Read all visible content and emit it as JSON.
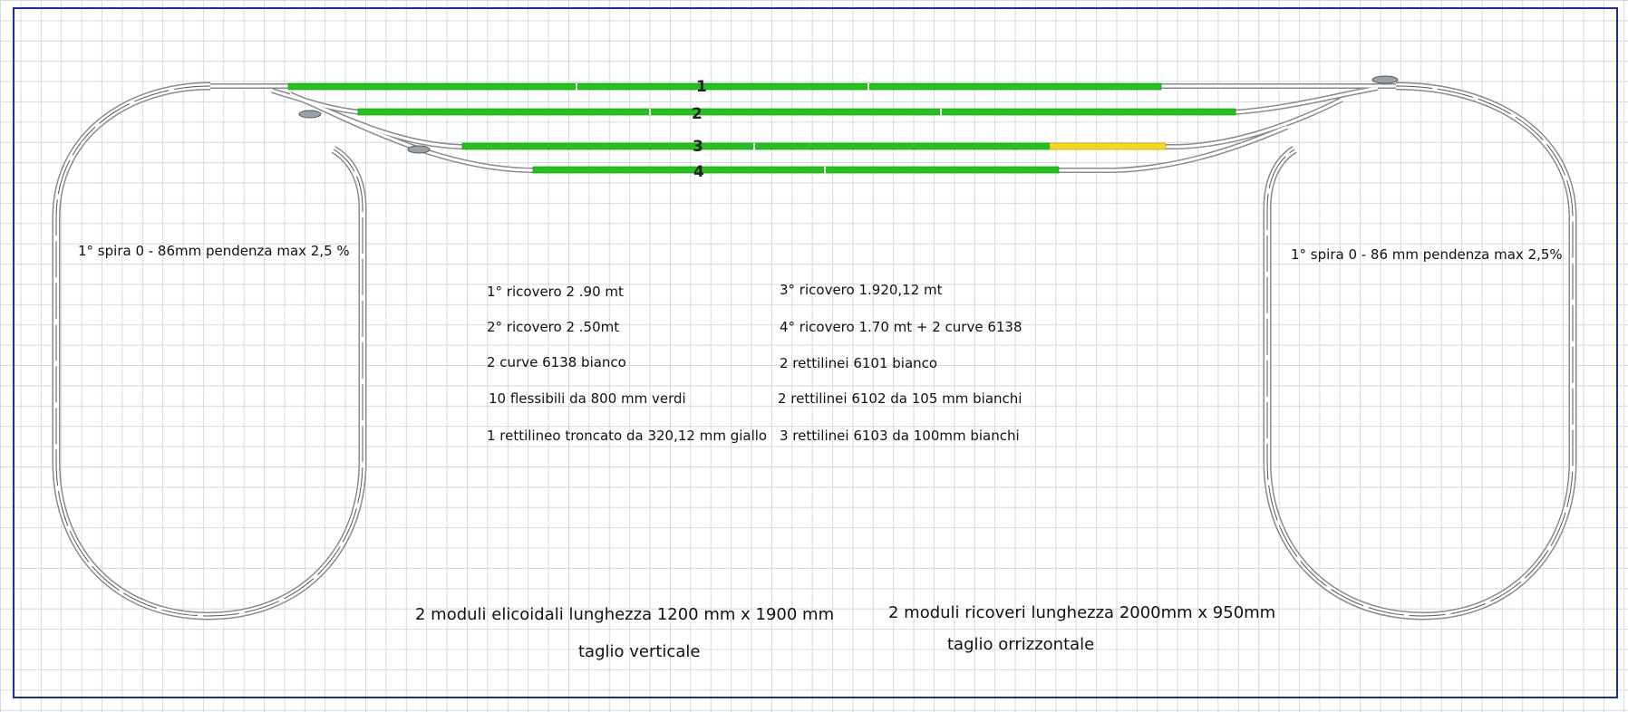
{
  "colors": {
    "frame": "#1a2ca8",
    "grid": "#d4d8e2",
    "track_green": "#22c41c",
    "track_yellow": "#f4d81a",
    "rail": "#666666"
  },
  "tracks": [
    {
      "number": "1"
    },
    {
      "number": "2"
    },
    {
      "number": "3"
    },
    {
      "number": "4"
    }
  ],
  "helix_left": {
    "label": "1° spira  0 - 86mm   pendenza max  2,5 %"
  },
  "helix_right": {
    "label": "1° spira  0 - 86 mm pendenza max 2,5%"
  },
  "notes_left": [
    "1° ricovero 2 .90 mt",
    "2° ricovero 2 .50mt",
    "2 curve 6138 bianco",
    "10 flessibili da 800 mm verdi",
    "1 rettilineo troncato da 320,12 mm giallo"
  ],
  "notes_right": [
    "3° ricovero 1.920,12 mt",
    "4° ricovero 1.70 mt + 2 curve 6138",
    "2 rettilinei 6101 bianco",
    "2 rettilinei 6102 da 105 mm bianchi",
    "3 rettilinei  6103 da 100mm bianchi"
  ],
  "footer_left": {
    "line1": "2 moduli elicoidali lunghezza 1200 mm x 1900 mm",
    "line2": "taglio verticale"
  },
  "footer_right": {
    "line1": "2 moduli ricoveri lunghezza 2000mm x 950mm",
    "line2": "taglio orrizzontale"
  }
}
